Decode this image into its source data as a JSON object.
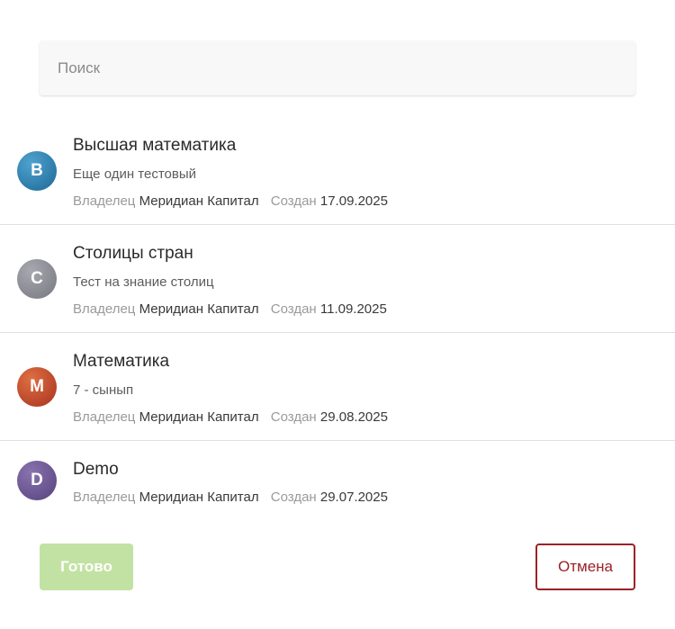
{
  "search": {
    "placeholder": "Поиск",
    "value": ""
  },
  "labels": {
    "owner": "Владелец",
    "created": "Создан"
  },
  "items": [
    {
      "initial": "В",
      "title": "Высшая математика",
      "description": "Еще один тестовый",
      "owner": "Меридиан Капитал",
      "created": "17.09.2025",
      "avatar_color": "#2f7fb0"
    },
    {
      "initial": "С",
      "title": "Столицы стран",
      "description": "Тест на знание столиц",
      "owner": "Меридиан Капитал",
      "created": "11.09.2025",
      "avatar_color": "#8e8e96"
    },
    {
      "initial": "М",
      "title": "Математика",
      "description": "7 - сынып",
      "owner": "Меридиан Капитал",
      "created": "29.08.2025",
      "avatar_color": "#c5452c"
    },
    {
      "initial": "D",
      "title": "Demo",
      "description": "",
      "owner": "Меридиан Капитал",
      "created": "29.07.2025",
      "avatar_color": "#6b5590"
    }
  ],
  "buttons": {
    "done": "Готово",
    "cancel": "Отмена"
  },
  "colors": {
    "done_bg": "#c2e2a3",
    "cancel_accent": "#9b2226"
  }
}
